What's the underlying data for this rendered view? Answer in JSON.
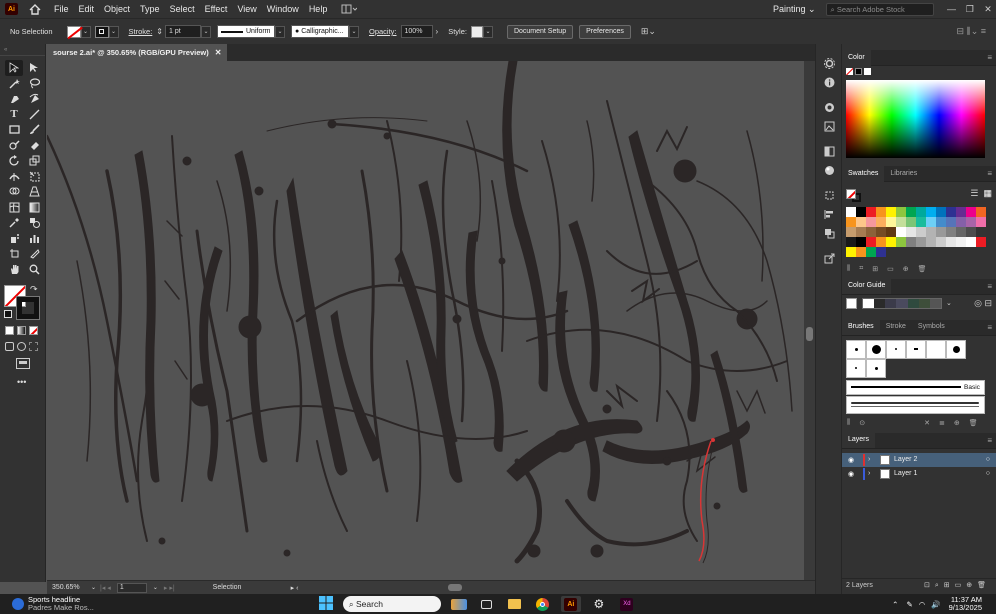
{
  "app": {
    "logo": "Ai",
    "menu": [
      "File",
      "Edit",
      "Object",
      "Type",
      "Select",
      "Effect",
      "View",
      "Window",
      "Help"
    ],
    "workspace": "Painting",
    "search_placeholder": "Search Adobe Stock"
  },
  "control_bar": {
    "selection": "No Selection",
    "stroke_label": "Stroke:",
    "stroke_weight": "1 pt",
    "stroke_profile": "Uniform",
    "brush": "Calligraphic...",
    "opacity_label": "Opacity:",
    "opacity_value": "100%",
    "style_label": "Style:",
    "document_setup": "Document Setup",
    "preferences": "Preferences"
  },
  "document": {
    "tab_title": "sourse 2.ai* @ 350.65% (RGB/GPU Preview)",
    "zoom": "350.65%",
    "artboard": "1",
    "status_tool": "Selection"
  },
  "panels": {
    "color_tab": "Color",
    "swatches_tabs": [
      "Swatches",
      "Libraries"
    ],
    "color_guide_tab": "Color Guide",
    "brushes_tabs": [
      "Brushes",
      "Stroke",
      "Symbols"
    ],
    "brush_basic": "Basic",
    "layers_tab": "Layers",
    "layers": [
      {
        "name": "Layer 2",
        "color": "#e03030",
        "selected": true
      },
      {
        "name": "Layer 1",
        "color": "#3a5bd9",
        "selected": false
      }
    ],
    "layers_count": "2 Layers",
    "swatch_colors": [
      "#ffffff",
      "#000000",
      "#ed1c24",
      "#f7941d",
      "#fff200",
      "#8dc63f",
      "#00a651",
      "#00a99d",
      "#00aeef",
      "#0072bc",
      "#2e3192",
      "#662d91",
      "#ec008c",
      "#f26522",
      "#f7941d",
      "#fdc689",
      "#f5989d",
      "#fbaf5d",
      "#fff799",
      "#c4df9b",
      "#7cc576",
      "#1abc9c",
      "#6dcff6",
      "#448ccb",
      "#5674b9",
      "#8560a8",
      "#a864a8",
      "#f06ea9",
      "#c69c6d",
      "#a67c52",
      "#8c6239",
      "#754c24",
      "#603913",
      "#ffffff",
      "#e6e6e6",
      "#cccccc",
      "#b3b3b3",
      "#999999",
      "#808080",
      "#666666",
      "#4d4d4d",
      "#333333",
      "#1a1a1a",
      "#000000",
      "#ed1c24",
      "#f7941d",
      "#fff200",
      "#8dc63f",
      "#808080",
      "#999999",
      "#b3b3b3",
      "#cccccc",
      "#e6e6e6",
      "#f2f2f2",
      "#ffffff",
      "#ed1c24",
      "#fff200",
      "#f7941d",
      "#00a651",
      "#2e3192"
    ],
    "guide_colors": [
      "#ffffff",
      "#2a2a2a",
      "#3b3b4a",
      "#4a4a5e",
      "#2f4a3e",
      "#3e4e3a",
      "#555"
    ]
  },
  "taskbar": {
    "news_title": "Sports headline",
    "news_sub": "Padres Make Ros...",
    "search": "Search",
    "time": "11:37 AM",
    "date": "9/13/2025"
  }
}
